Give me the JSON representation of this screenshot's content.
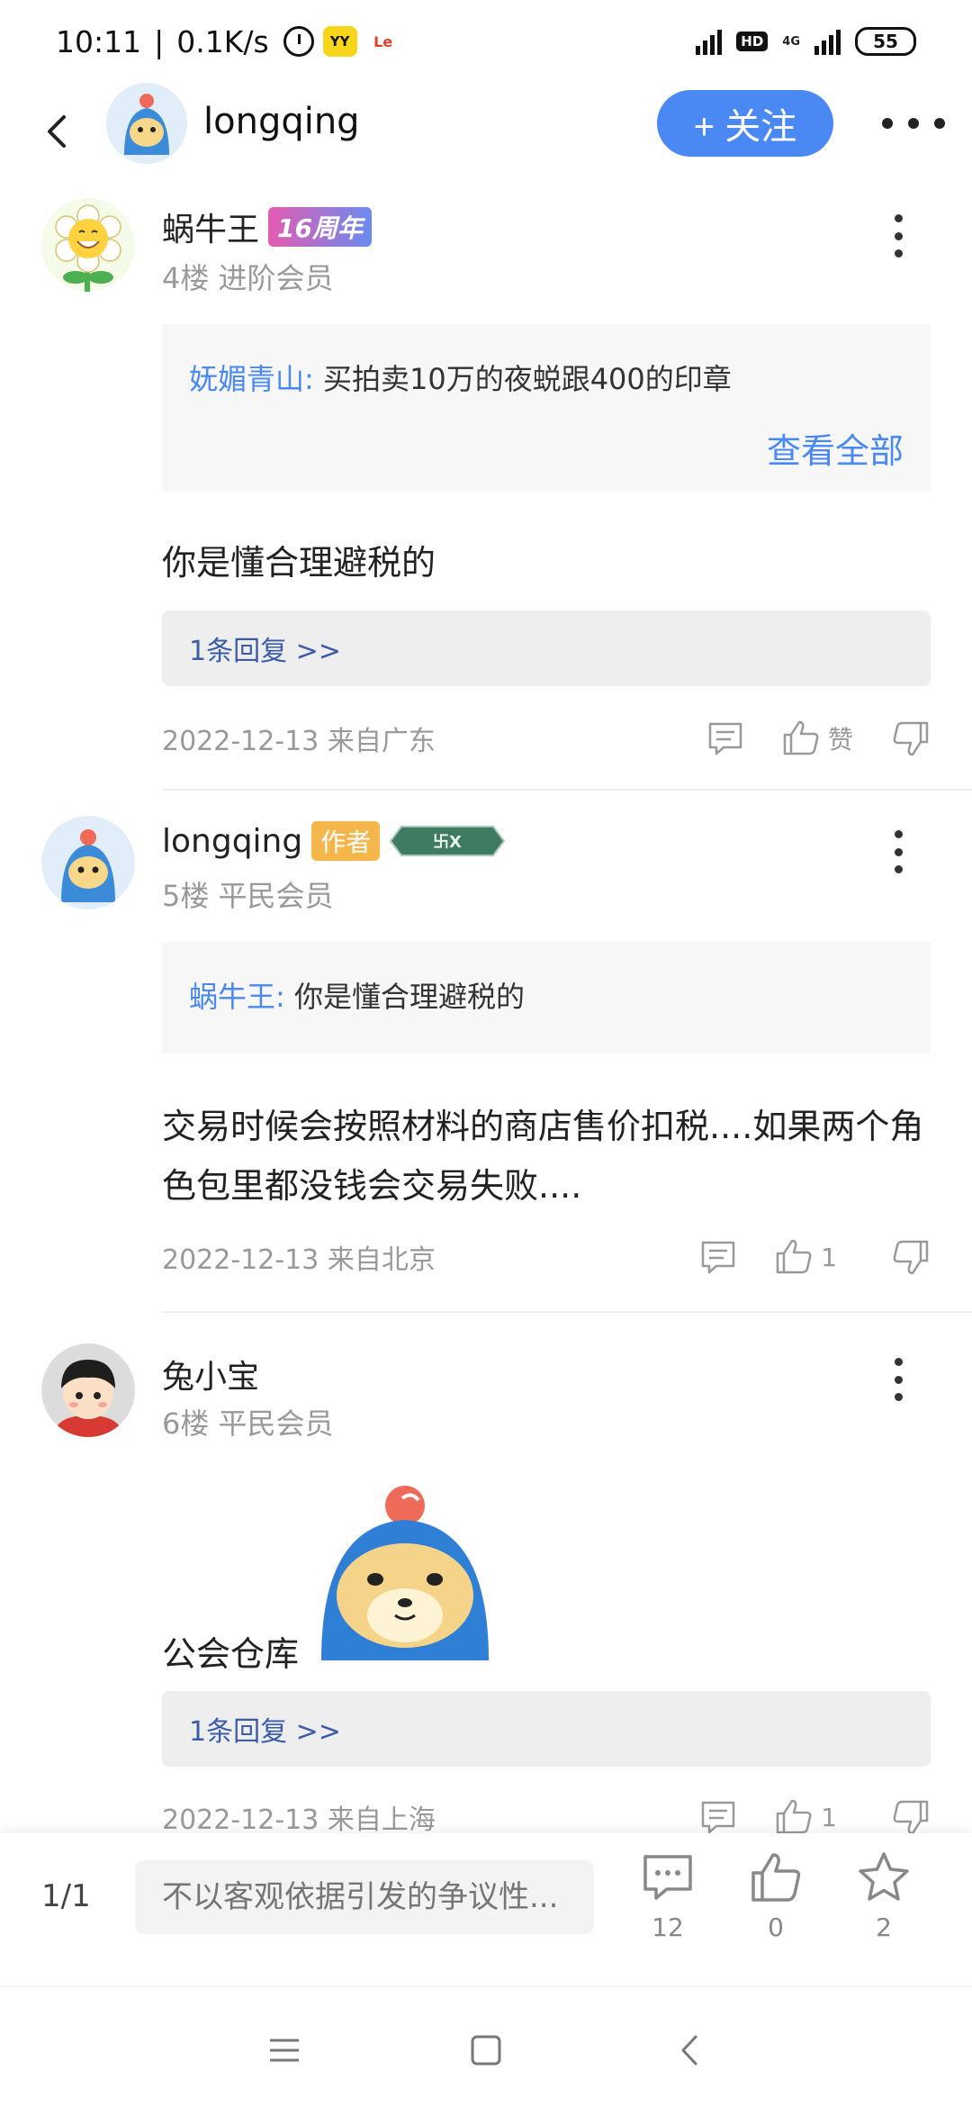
{
  "status": {
    "time": "10:11",
    "speed": "0.1K/s",
    "separator": "|",
    "yy_icon": "YY",
    "le_icon": "Le",
    "hd": "HD",
    "network": "4G",
    "battery": "55"
  },
  "header": {
    "name": "longqing",
    "follow_label": "+ 关注"
  },
  "posts": [
    {
      "username": "蜗牛王",
      "badge": "16周年",
      "floor_info": "4楼 进阶会员",
      "quote_name": "妩媚青山:",
      "quote_text": "买拍卖10万的夜蜕跟400的印章",
      "view_all": "查看全部",
      "content": "你是懂合理避税的",
      "reply_link": "1条回复 >>",
      "meta": "2022-12-13 来自广东",
      "like_label": "赞"
    },
    {
      "username": "longqing",
      "badge": "作者",
      "level_badge": "卐X",
      "floor_info": "5楼 平民会员",
      "quote_name": "蜗牛王:",
      "quote_text": "你是懂合理避税的",
      "content": "交易时候会按照材料的商店售价扣税....如果两个角色包里都没钱会交易失败....",
      "meta": "2022-12-13 来自北京",
      "like_label": "1"
    },
    {
      "username": "兔小宝",
      "floor_info": "6楼 平民会员",
      "content": "公会仓库",
      "reply_link": "1条回复 >>",
      "meta": "2022-12-13 来自上海",
      "like_label": "1"
    }
  ],
  "bottom_bar": {
    "page_indicator": "1/1",
    "input_placeholder": "不以客观依据引发的争议性...",
    "comment_count": "12",
    "like_count": "0",
    "star_count": "2"
  },
  "colors": {
    "accent": "#4a89f3",
    "reply_link": "#3b5da8",
    "author_badge": "#f5b74b"
  },
  "icons": [
    "back-icon",
    "more-icon",
    "kebab-icon",
    "comment-icon",
    "thumb-up-icon",
    "thumb-down-icon",
    "star-icon",
    "menu-icon",
    "home-icon",
    "nav-back-icon"
  ]
}
